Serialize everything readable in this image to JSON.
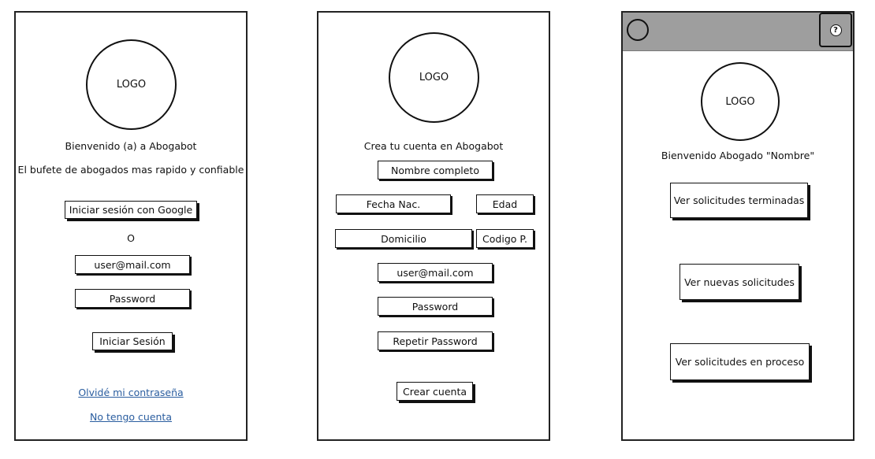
{
  "login": {
    "logo": "LOGO",
    "welcome": "Bienvenido (a) a Abogabot",
    "tagline": "El bufete de abogados mas rapido y confiable",
    "google_button": "Iniciar sesión con Google",
    "or_text": "O",
    "email_field": "user@mail.com",
    "password_field": "Password",
    "login_button": "Iniciar Sesión",
    "forgot_link": "Olvidé mi contraseña",
    "no_account_link": "No tengo cuenta"
  },
  "register": {
    "logo": "LOGO",
    "title": "Crea tu cuenta en Abogabot",
    "full_name": "Nombre completo",
    "birth_date": "Fecha Nac.",
    "age": "Edad",
    "address": "Domicilio",
    "postal_code": "Codigo P.",
    "email": "user@mail.com",
    "password": "Password",
    "repeat_password": "Repetir Password",
    "create_button": "Crear cuenta"
  },
  "dashboard": {
    "help_icon": "?",
    "logo": "LOGO",
    "welcome": "Bienvenido Abogado \"Nombre\"",
    "finished_button": "Ver solicitudes terminadas",
    "new_button": "Ver nuevas solicitudes",
    "in_progress_button": "Ver solicitudes en proceso"
  },
  "colors": {
    "link": "#2a5d9f",
    "topbar": "#9e9e9e",
    "stroke": "#111111"
  }
}
